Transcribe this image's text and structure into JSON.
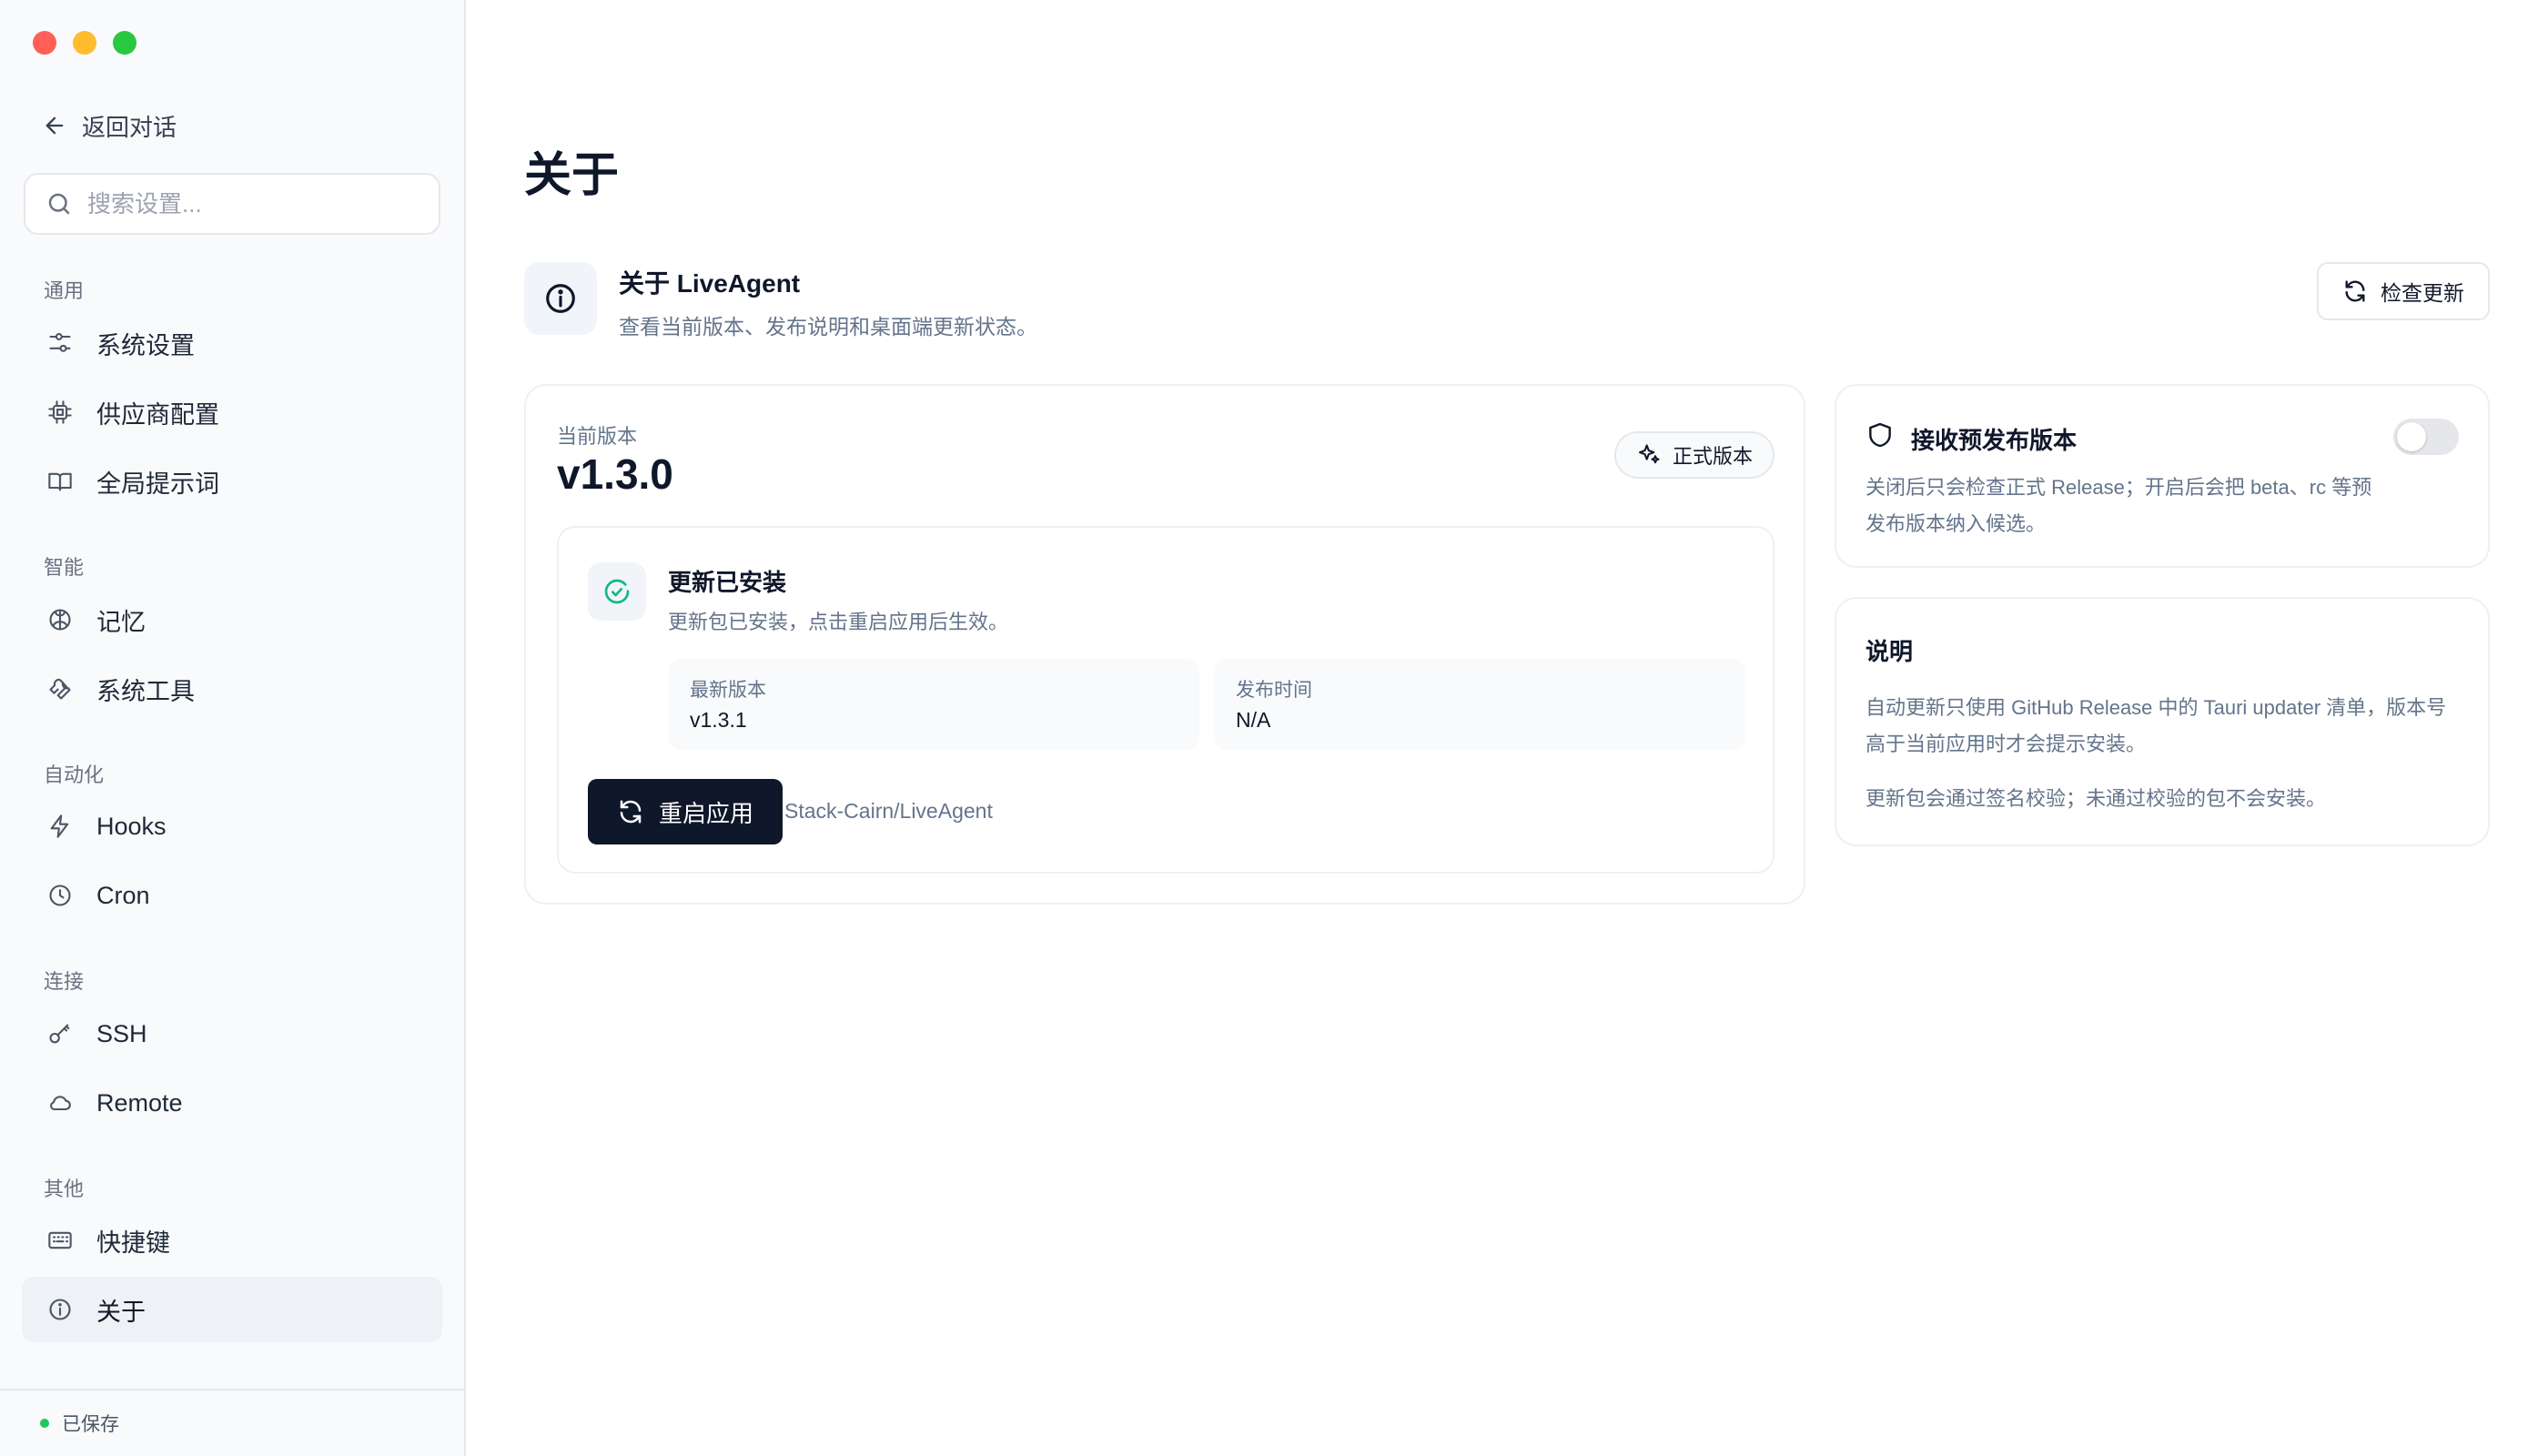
{
  "sidebar": {
    "back_label": "返回对话",
    "search_placeholder": "搜索设置...",
    "sections": [
      {
        "label": "通用",
        "items": [
          {
            "label": "系统设置",
            "icon": "sliders-icon"
          },
          {
            "label": "供应商配置",
            "icon": "chip-icon"
          },
          {
            "label": "全局提示词",
            "icon": "book-icon"
          }
        ]
      },
      {
        "label": "智能",
        "items": [
          {
            "label": "记忆",
            "icon": "brain-icon"
          },
          {
            "label": "系统工具",
            "icon": "wrench-icon"
          }
        ]
      },
      {
        "label": "自动化",
        "items": [
          {
            "label": "Hooks",
            "icon": "lightning-icon"
          },
          {
            "label": "Cron",
            "icon": "clock-icon"
          }
        ]
      },
      {
        "label": "连接",
        "items": [
          {
            "label": "SSH",
            "icon": "key-icon"
          },
          {
            "label": "Remote",
            "icon": "cloud-icon"
          }
        ]
      },
      {
        "label": "其他",
        "items": [
          {
            "label": "快捷键",
            "icon": "keyboard-icon"
          },
          {
            "label": "关于",
            "icon": "info-icon",
            "active": true
          }
        ]
      }
    ],
    "footer_status": "已保存",
    "status_color": "#22c55e"
  },
  "main": {
    "page_title": "关于",
    "about": {
      "title": "关于 LiveAgent",
      "subtitle": "查看当前版本、发布说明和桌面端更新状态。",
      "check_update_label": "检查更新"
    },
    "version_card": {
      "label": "当前版本",
      "value": "v1.3.0",
      "badge": "正式版本",
      "installed": {
        "title": "更新已安装",
        "desc": "更新包已安装，点击重启应用后生效。",
        "latest_label": "最新版本",
        "latest_value": "v1.3.1",
        "release_label": "发布时间",
        "release_value": "N/A",
        "restart_label": "重启应用",
        "repo": "Stack-Cairn/LiveAgent"
      }
    },
    "prerelease": {
      "title": "接收预发布版本",
      "desc": "关闭后只会检查正式 Release；开启后会把 beta、rc 等预发布版本纳入候选。",
      "enabled": false
    },
    "notes": {
      "title": "说明",
      "p1": "自动更新只使用 GitHub Release 中的 Tauri updater 清单，版本号高于当前应用时才会提示安装。",
      "p2": "更新包会通过签名校验；未通过校验的包不会安装。"
    }
  },
  "colors": {
    "accent_dark": "#0f172a",
    "success_green": "#10b981",
    "muted_text": "#64748b"
  }
}
